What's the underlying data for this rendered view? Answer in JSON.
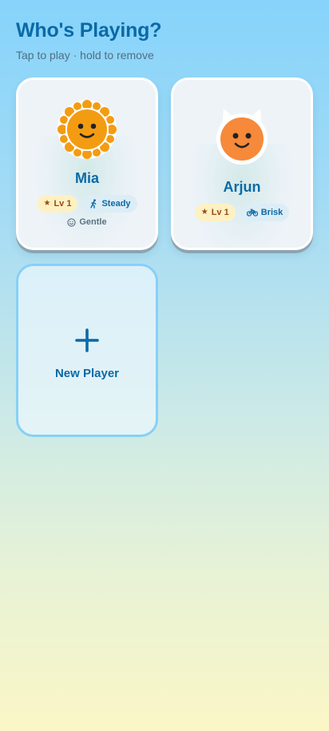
{
  "header": {
    "title": "Who's Playing?",
    "subtitle": "Tap to play · hold to remove"
  },
  "players": [
    {
      "name": "Mia",
      "avatar_icon": "sunflower-face-icon",
      "level_label": "Lv 1",
      "speed_label": "Steady",
      "speed_icon": "running-person-icon",
      "mood_label": "Gentle",
      "mood_icon": "smiley-icon"
    },
    {
      "name": "Arjun",
      "avatar_icon": "cat-face-icon",
      "level_label": "Lv 1",
      "speed_label": "Brisk",
      "speed_icon": "bicycle-icon"
    }
  ],
  "new_player": {
    "label": "New Player",
    "icon": "plus-icon"
  },
  "colors": {
    "accent": "#0a6aa6",
    "level_bg": "#fdf1c4",
    "level_text": "#9a4a12",
    "sunflower": "#f39c12",
    "cat": "#f6893a"
  }
}
